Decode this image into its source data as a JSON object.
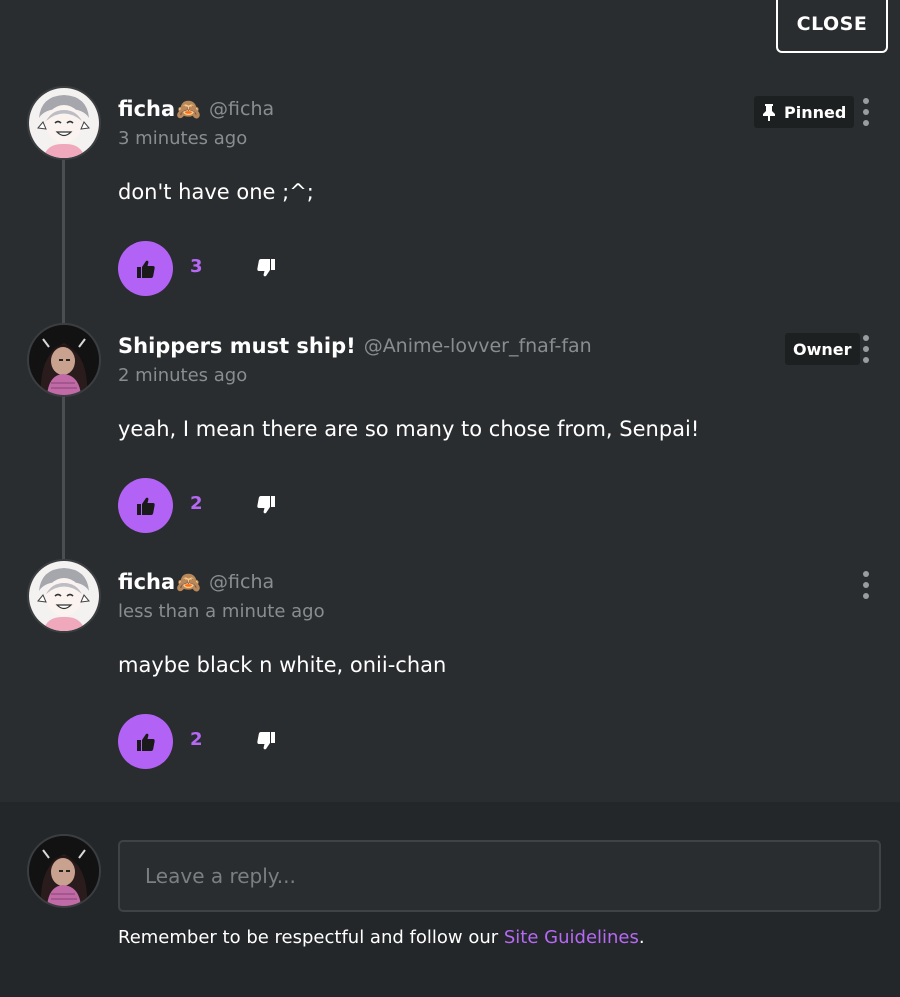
{
  "header": {
    "close_label": "CLOSE"
  },
  "comments": [
    {
      "name": "ficha",
      "emoji": "🙈",
      "handle": "@ficha",
      "time": "3 minutes ago",
      "text": "don't have one ;^;",
      "likes": "3",
      "badge": "Pinned",
      "badge_icon": "pin-icon",
      "avatar": "avatar-light"
    },
    {
      "name": "Shippers must ship!",
      "emoji": "",
      "handle": "@Anime-lovver_fnaf-fan",
      "time": "2 minutes ago",
      "text": "yeah, I mean there are so many to chose from, Senpai!",
      "likes": "2",
      "badge": "Owner",
      "avatar": "avatar-dark"
    },
    {
      "name": "ficha",
      "emoji": "🙈",
      "handle": "@ficha",
      "time": "less than a minute ago",
      "text": "maybe black n white, onii-chan",
      "likes": "2",
      "avatar": "avatar-light"
    }
  ],
  "reply": {
    "placeholder": "Leave a reply...",
    "notice_prefix": "Remember to be respectful and follow our ",
    "notice_link": "Site Guidelines",
    "notice_suffix": "."
  },
  "colors": {
    "background": "#2a2d2f",
    "accent": "#b362f6",
    "muted_text": "#8a8d90",
    "reply_section_bg": "#232729"
  },
  "icons": [
    "pin-icon",
    "thumbs-up-icon",
    "thumbs-down-icon",
    "kebab-menu-icon"
  ]
}
